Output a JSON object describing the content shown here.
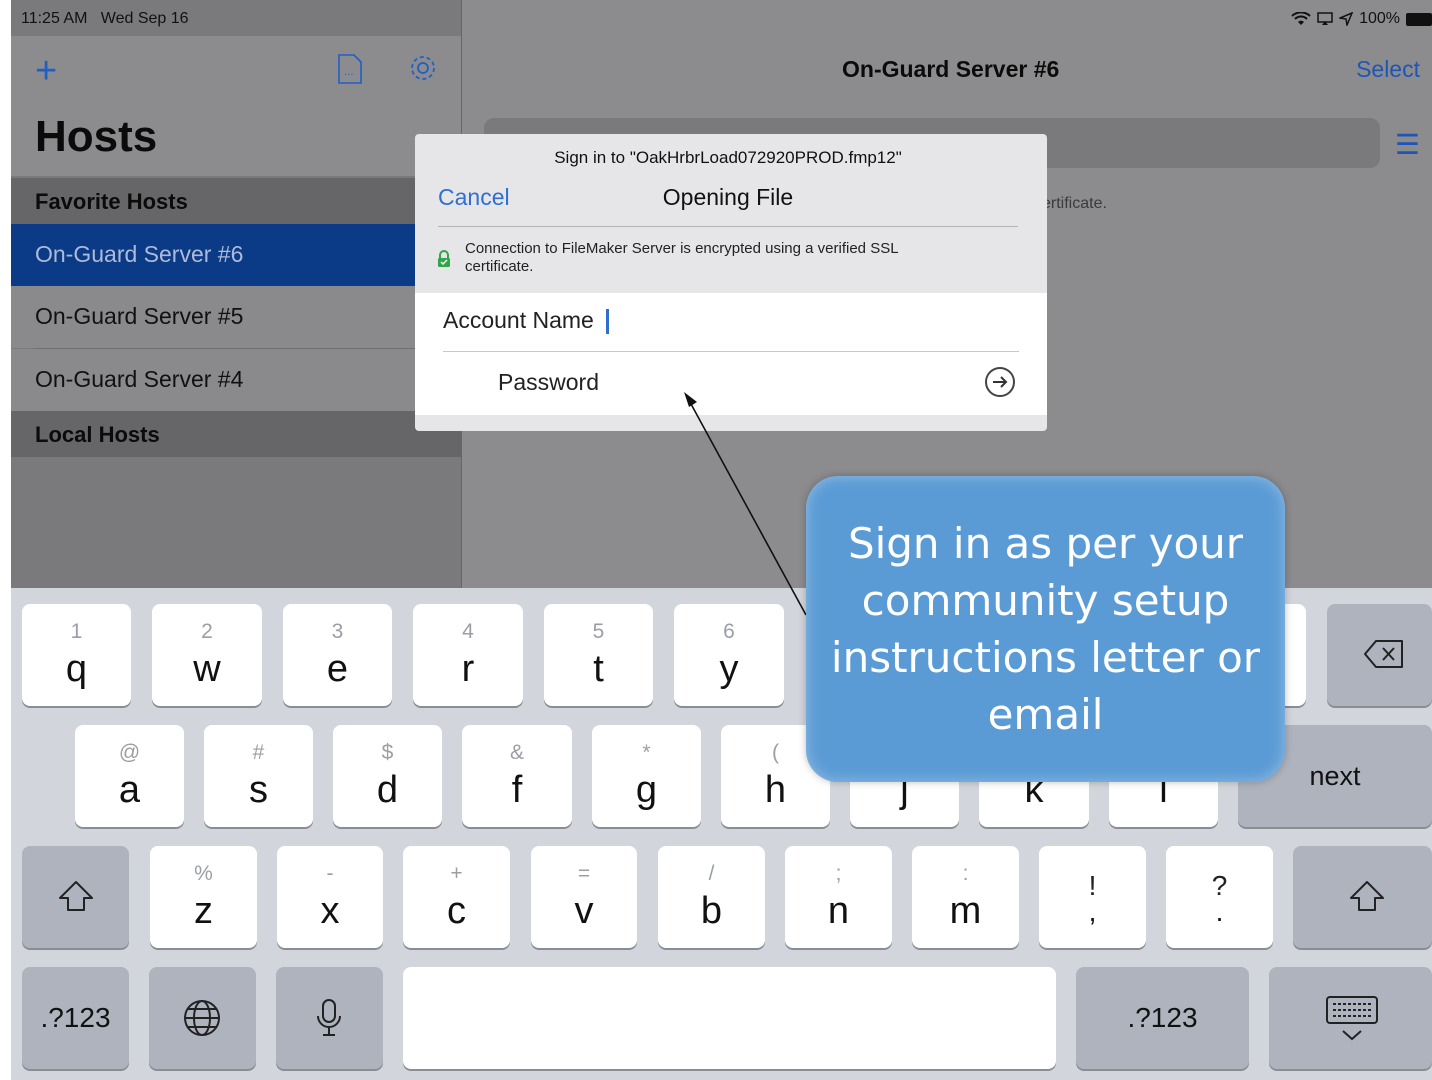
{
  "status_bar": {
    "time": "11:25 AM",
    "date": "Wed Sep 16",
    "battery": "100%"
  },
  "sidebar": {
    "title": "Hosts",
    "sections": [
      {
        "label": "Favorite Hosts",
        "items": [
          "On-Guard Server #6",
          "On-Guard Server #5",
          "On-Guard Server #4"
        ]
      },
      {
        "label": "Local Hosts",
        "items": []
      }
    ],
    "selected": "On-Guard Server #6"
  },
  "detail": {
    "title": "On-Guard Server #6",
    "select_label": "Select",
    "info_fragment": "ertificate."
  },
  "dialog": {
    "subtitle": "Sign in to \"OakHrbrLoad072920PROD.fmp12\"",
    "title": "Opening File",
    "cancel_label": "Cancel",
    "note": "Connection to FileMaker Server is encrypted using a verified SSL certificate.",
    "account_label": "Account Name",
    "password_label": "Password"
  },
  "keyboard": {
    "row1": [
      {
        "sec": "1",
        "pri": "q"
      },
      {
        "sec": "2",
        "pri": "w"
      },
      {
        "sec": "3",
        "pri": "e"
      },
      {
        "sec": "4",
        "pri": "r"
      },
      {
        "sec": "5",
        "pri": "t"
      },
      {
        "sec": "6",
        "pri": "y"
      }
    ],
    "row2": [
      {
        "sec": "@",
        "pri": "a"
      },
      {
        "sec": "#",
        "pri": "s"
      },
      {
        "sec": "$",
        "pri": "d"
      },
      {
        "sec": "&",
        "pri": "f"
      },
      {
        "sec": "*",
        "pri": "g"
      },
      {
        "sec": "(",
        "pri": "h"
      },
      {
        "sec": "",
        "pri": "j"
      },
      {
        "sec": "",
        "pri": "k"
      },
      {
        "sec": "",
        "pri": "l"
      }
    ],
    "row3": [
      {
        "sec": "%",
        "pri": "z"
      },
      {
        "sec": "-",
        "pri": "x"
      },
      {
        "sec": "+",
        "pri": "c"
      },
      {
        "sec": "=",
        "pri": "v"
      },
      {
        "sec": "/",
        "pri": "b"
      },
      {
        "sec": ";",
        "pri": "n"
      },
      {
        "sec": ":",
        "pri": "m"
      },
      {
        "sec": "!",
        "pri": ","
      },
      {
        "sec": "?",
        "pri": "."
      }
    ],
    "next_label": "next",
    "numbers_label": ".?123"
  },
  "callout": {
    "text": "Sign in as per your community setup instructions letter or email",
    "color": "#5b9bd5"
  }
}
